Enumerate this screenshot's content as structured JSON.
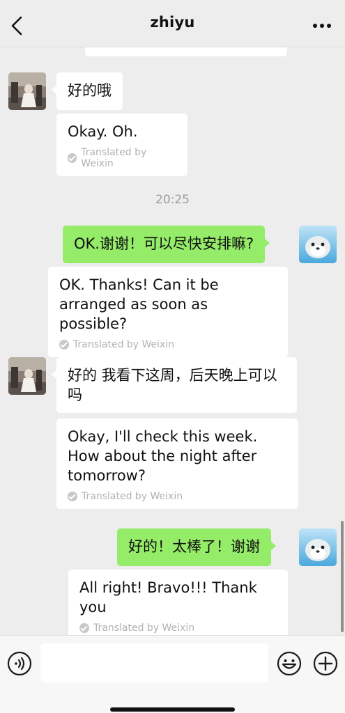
{
  "header": {
    "title": "zhiyu",
    "back_icon": "chevron-left-icon",
    "more_icon": "more-dots-icon"
  },
  "timestamp": "20:25",
  "messages": [
    {
      "side": "left",
      "text": "好的哦",
      "translation": "Okay. Oh.",
      "translated_by": "Translated by Weixin"
    },
    {
      "side": "right",
      "text": "OK.谢谢！可以尽快安排嘛?",
      "translation": "OK. Thanks! Can it be arranged as soon as possible?",
      "translated_by": "Translated by Weixin"
    },
    {
      "side": "left",
      "text": "好的 我看下这周，后天晚上可以吗",
      "translation": "Okay, I'll check this week. How about the night after tomorrow?",
      "translated_by": "Translated by Weixin"
    },
    {
      "side": "right",
      "text": "好的！太棒了！谢谢",
      "translation": "All right! Bravo!!! Thank you",
      "translated_by": "Translated by Weixin"
    }
  ],
  "input_bar": {
    "voice_icon": "voice-icon",
    "emoji_icon": "emoji-icon",
    "plus_icon": "plus-icon",
    "input_value": ""
  },
  "colors": {
    "background": "#ededed",
    "outgoing_bubble": "#95ec69",
    "incoming_bubble": "#ffffff"
  }
}
